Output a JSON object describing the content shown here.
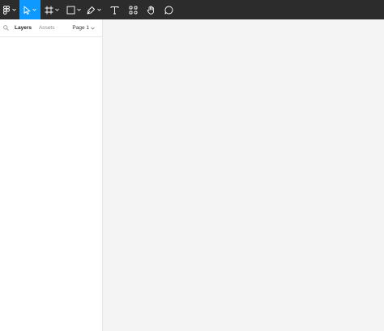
{
  "toolbar": {
    "tools": [
      {
        "name": "main-menu",
        "icon": "figma-logo-icon"
      },
      {
        "name": "move-tool",
        "icon": "pointer-icon",
        "active": true
      },
      {
        "name": "frame-tool",
        "icon": "frame-icon"
      },
      {
        "name": "shape-tool",
        "icon": "rectangle-icon"
      },
      {
        "name": "pen-tool",
        "icon": "pen-icon"
      },
      {
        "name": "text-tool",
        "icon": "text-icon"
      },
      {
        "name": "resources-tool",
        "icon": "components-icon"
      },
      {
        "name": "hand-tool",
        "icon": "hand-icon"
      },
      {
        "name": "comment-tool",
        "icon": "comment-icon"
      }
    ],
    "accent_color": "#0d99ff",
    "background_color": "#2c2c2c"
  },
  "left_panel": {
    "search_icon": "search-icon",
    "tabs": {
      "layers": "Layers",
      "assets": "Assets"
    },
    "page_selector": "Page 1"
  },
  "canvas": {
    "background_color": "#f4f4f4"
  }
}
